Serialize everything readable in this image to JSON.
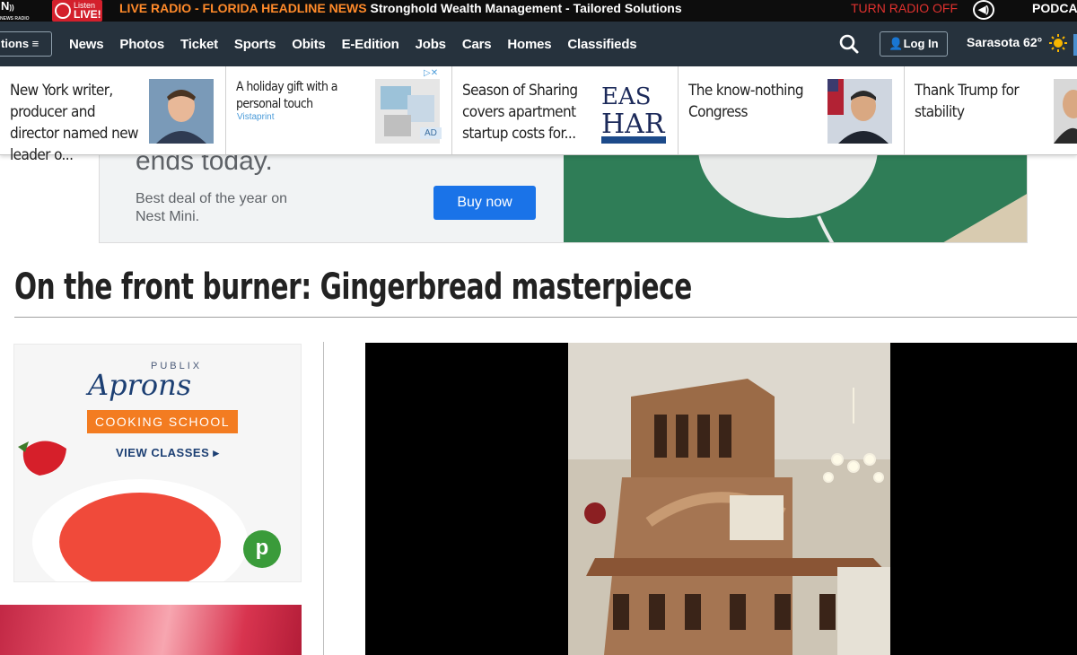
{
  "radio_bar": {
    "logo_text": "N",
    "logo_sub": "NEWS RADIO",
    "listen_line1": "Listen",
    "listen_line2": "LIVE!",
    "live_label": "LIVE RADIO - FLORIDA HEADLINE NEWS",
    "live_ad": "Stronghold Wealth Management - Tailored Solutions",
    "turn_off": "TURN RADIO OFF",
    "podcast": "PODCAS"
  },
  "nav": {
    "sections_label": "tions ≡",
    "items": [
      "News",
      "Photos",
      "Ticket",
      "Sports",
      "Obits",
      "E-Edition",
      "Jobs",
      "Cars",
      "Homes",
      "Classifieds"
    ],
    "login_label": "Log In",
    "weather": "Sarasota 62°"
  },
  "recommendations": [
    {
      "title": "New York writer, producer and director named new leader o..."
    },
    {
      "title": "A holiday gift with a personal touch",
      "sponsor": "Vistaprint",
      "badge": "AD"
    },
    {
      "title": "Season of Sharing covers apartment startup costs for..."
    },
    {
      "title": "The know-nothing Congress"
    },
    {
      "title": "Thank Trump for stability"
    }
  ],
  "ad_banner": {
    "headline": "ends today.",
    "sub": "Best deal of the year on Nest Mini.",
    "button": "Buy now"
  },
  "article": {
    "title": "On the front burner: Gingerbread masterpiece"
  },
  "publix_ad": {
    "brand_small": "PUBLIX",
    "brand_big": "Aprons",
    "school": "COOKING SCHOOL",
    "view": "VIEW CLASSES ▸",
    "logo": "p"
  },
  "colors": {
    "nav_bg": "#26323d",
    "accent_red": "#d3202c",
    "live_orange": "#ff8a2a",
    "ad_button": "#1a73e8"
  }
}
